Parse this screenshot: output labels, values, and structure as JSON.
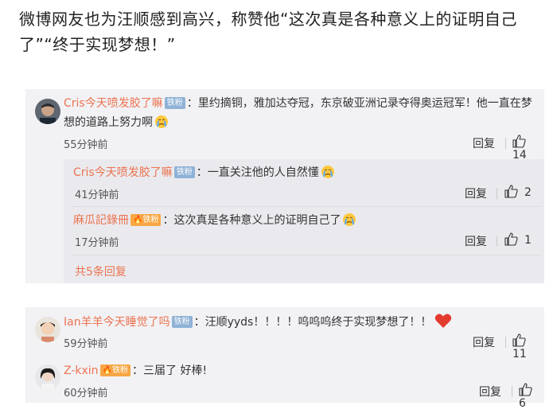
{
  "headline": "微博网友也为汪顺感到高兴，称赞他“这次真是各种意义上的证明自己了”“终于实现梦想！”",
  "comments": [
    {
      "user": "Cris今天喷发胶了嘛",
      "badge": "铁粉",
      "text": "：里约摘铜，雅加达夺冠，东京破亚洲记录夺得奥运冠军！他一直在梦想的道路上努力啊",
      "emoji": "crying-emoji",
      "time": "55分钟前",
      "reply": "回复",
      "likes": "14"
    },
    {
      "user": "Cris今天喷发胶了嘛",
      "badge": "铁粉",
      "text": "：一直关注他的人自然懂",
      "emoji": "crying-emoji",
      "time": "41分钟前",
      "reply": "回复",
      "likes": "2"
    },
    {
      "user": "麻瓜記錄冊",
      "badge": "铁粉",
      "text": "：这次真是各种意义上的证明自己了",
      "emoji": "crying-emoji",
      "time": "17分钟前",
      "reply": "回复",
      "likes": "1"
    },
    {
      "user": "Ian羊羊今天睡觉了吗",
      "badge": "铁粉",
      "text": "：汪顺yyds！！！！呜呜呜终于实现梦想了！！",
      "emoji": "heart-emoji",
      "time": "59分钟前",
      "reply": "回复",
      "likes": "11"
    },
    {
      "user": "Z-kxin",
      "badge": "铁粉",
      "text": "：三届了 好棒!",
      "time": "60分钟前",
      "reply": "回复",
      "likes": "6"
    }
  ],
  "more_replies": "共5条回复",
  "colors": {
    "username": "#eb7350",
    "panel_bg": "#f2f2f5",
    "badge_blue": "#8fb2d6",
    "badge_orange": "#f7a745"
  }
}
